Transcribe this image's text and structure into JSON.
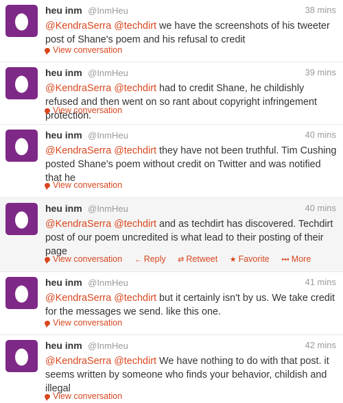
{
  "tweets": [
    {
      "name": "heu inm",
      "handle": "@InmHeu",
      "time": "38 mins",
      "mentions": [
        "@KendraSerra",
        "@techdirt"
      ],
      "body": " we have the screenshots of his tweeter post of Shane's poem and his refusal to credit",
      "view_label": "View conversation"
    },
    {
      "name": "heu inm",
      "handle": "@InmHeu",
      "time": "39 mins",
      "mentions": [
        "@KendraSerra",
        "@techdirt"
      ],
      "body": " had to credit Shane, he childishly refused and then went on so rant about copyright infringement protection.",
      "view_label": "View conversation"
    },
    {
      "name": "heu inm",
      "handle": "@InmHeu",
      "time": "40 mins",
      "mentions": [
        "@KendraSerra",
        "@techdirt"
      ],
      "body": " they have not been truthful. Tim Cushing posted Shane's poem without credit on Twitter and was notified that he",
      "view_label": "View conversation"
    },
    {
      "name": "heu inm",
      "handle": "@InmHeu",
      "time": "40 mins",
      "mentions": [
        "@KendraSerra",
        "@techdirt"
      ],
      "body": " and as techdirt has discovered. Techdirt post of our poem uncredited is what lead to their posting of their page",
      "view_label": "View conversation",
      "reply_label": "Reply",
      "retweet_label": "Retweet",
      "favorite_label": "Favorite",
      "more_label": "More"
    },
    {
      "name": "heu inm",
      "handle": "@InmHeu",
      "time": "41 mins",
      "mentions": [
        "@KendraSerra",
        "@techdirt"
      ],
      "body": " but it certainly isn't by us. We take credit for the messages we send. like this one.",
      "view_label": "View conversation"
    },
    {
      "name": "heu inm",
      "handle": "@InmHeu",
      "time": "42 mins",
      "mentions": [
        "@KendraSerra",
        "@techdirt"
      ],
      "body": " We have nothing to do with that post. it seems written by someone who finds your behavior, childish and illegal",
      "view_label": "View conversation"
    }
  ],
  "colors": {
    "link": "#d9461e",
    "avatar_bg": "#7e2987",
    "hover_bg": "#f5f5f5"
  },
  "icons": {
    "avatar": "default-egg-avatar-icon",
    "conversation": "speech-bubble-icon",
    "reply": "reply-arrow-icon",
    "retweet": "retweet-icon",
    "favorite": "star-icon",
    "more": "more-dots-icon"
  }
}
